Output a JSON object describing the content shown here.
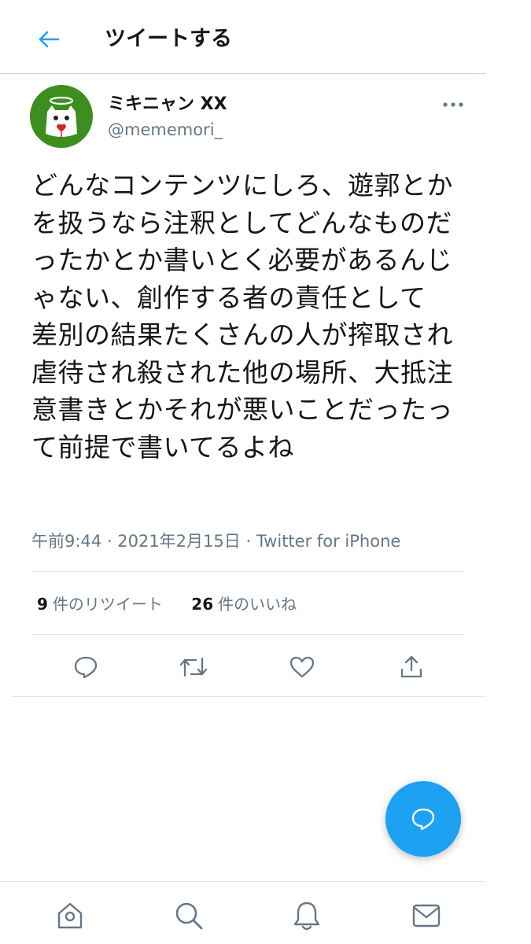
{
  "header": {
    "title": "ツイートする",
    "back_icon": "arrow-left-icon"
  },
  "author": {
    "display_name": "ミキニャン XX",
    "handle": "@mememori_",
    "avatar_bg": "#3c8f1e"
  },
  "tweet": {
    "text": "どんなコンテンツにしろ、遊郭とかを扱うなら注釈としてどんなものだったかとか書いとく必要があるんじゃない、創作する者の責任として\n差別の結果たくさんの人が搾取され虐待され殺された他の場所、大抵注意書きとかそれが悪いことだったって前提で書いてるよね",
    "time": "午前9:44",
    "date": "2021年2月15日",
    "source": "Twitter for iPhone",
    "separator": "·"
  },
  "stats": {
    "retweets_count": "9",
    "retweets_label": "件のリツイート",
    "likes_count": "26",
    "likes_label": "件のいいね"
  },
  "actions": [
    "reply-icon",
    "retweet-icon",
    "like-heart-icon",
    "share-icon"
  ],
  "tabs": [
    "home-icon",
    "search-icon",
    "notifications-bell-icon",
    "messages-envelope-icon"
  ],
  "colors": {
    "accent": "#1da1f2",
    "secondary_text": "#657786",
    "icon": "#657786",
    "border": "#e1e8ed"
  }
}
